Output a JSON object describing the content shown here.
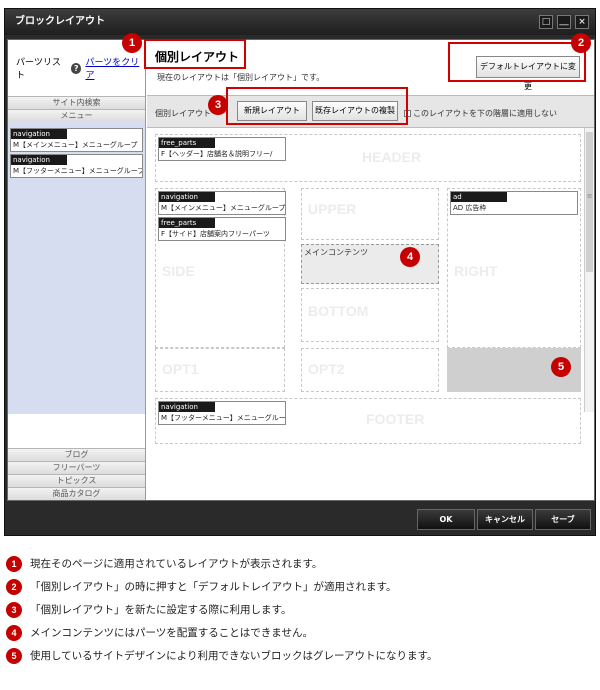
{
  "window": {
    "title": "ブロックレイアウト",
    "buttons": [
      "□",
      "＿",
      "×"
    ]
  },
  "left": {
    "parts_list_label": "パーツリスト",
    "help_icon": "?",
    "clear_link": "パーツをクリア",
    "search_header": "サイト内検索",
    "menu_header": "メニュー",
    "menu_parts": [
      {
        "type": "navigation",
        "name": "M【メインメニュー】メニューグループ"
      },
      {
        "type": "navigation",
        "name": "M【フッターメニュー】メニューグループ"
      }
    ],
    "bottom_headers": [
      "ブログ",
      "フリーパーツ",
      "トピックス",
      "商品カタログ"
    ]
  },
  "right": {
    "title": "個別レイアウト",
    "description": "現在のレイアウトは「個別レイアウト」です。",
    "default_button": "デフォルトレイアウトに変更",
    "toolbar_label": "個別レイアウト",
    "new_layout_button": "新規レイアウト",
    "copy_layout_button": "既存レイアウトの複製",
    "apply_checkbox_label": "このレイアウトを下の階層に適用しない"
  },
  "layout": {
    "header_label": "HEADER",
    "upper_label": "UPPER",
    "side_label": "SIDE",
    "right_label": "RIGHT",
    "bottom_label": "BOTTOM",
    "opt1_label": "OPT1",
    "opt2_label": "OPT2",
    "footer_label": "FOOTER",
    "main_contents_label": "メインコンテンツ",
    "header_part": {
      "type": "free_parts",
      "name": "F【ヘッダー】店舗名＆説明フリー/"
    },
    "side_parts": [
      {
        "type": "navigation",
        "name": "M【メインメニュー】メニューグループ"
      },
      {
        "type": "free_parts",
        "name": "F【サイド】店舗案内フリーパーツ"
      }
    ],
    "right_part": {
      "type": "ad",
      "name": "AD 広告枠"
    },
    "footer_part": {
      "type": "navigation",
      "name": "M【フッターメニュー】メニューグループ"
    }
  },
  "footer_buttons": {
    "ok": "OK",
    "cancel": "キャンセル",
    "save": "セーブ"
  },
  "callouts": [
    "1",
    "2",
    "3",
    "4",
    "5"
  ],
  "notes": [
    {
      "num": "1",
      "text": "現在そのページに適用されているレイアウトが表示されます。"
    },
    {
      "num": "2",
      "text": "「個別レイアウト」の時に押すと「デフォルトレイアウト」が適用されます。"
    },
    {
      "num": "3",
      "text": "「個別レイアウト」を新たに設定する際に利用します。"
    },
    {
      "num": "4",
      "text": "メインコンテンツにはパーツを配置することはできません。"
    },
    {
      "num": "5",
      "text": "使用しているサイトデザインにより利用できないブロックはグレーアウトになります。"
    }
  ]
}
